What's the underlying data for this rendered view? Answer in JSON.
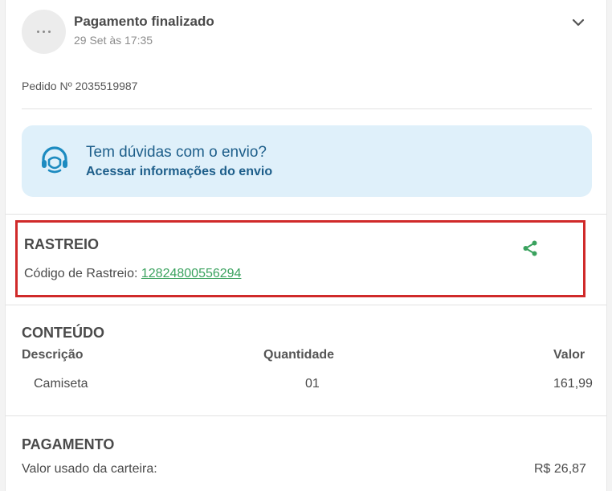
{
  "header": {
    "title": "Pagamento finalizado",
    "date": "29 Set às 17:35"
  },
  "order": {
    "label": "Pedido Nº 2035519987"
  },
  "banner": {
    "question": "Tem dúvidas com o envio?",
    "link": "Acessar informações do envio"
  },
  "tracking": {
    "title": "RASTREIO",
    "code_label": "Código de Rastreio:",
    "code": "12824800556294"
  },
  "content": {
    "title": "CONTEÚDO",
    "columns": [
      "Descrição",
      "Quantidade",
      "Valor"
    ],
    "rows": [
      {
        "description": "Camiseta",
        "quantity": "01",
        "value": "161,99"
      }
    ]
  },
  "payment": {
    "title": "PAGAMENTO",
    "wallet_label": "Valor usado da carteira:",
    "wallet_value": "R$ 26,87"
  },
  "icons": {
    "more": "more-dots-icon",
    "expand": "chevron-down-icon",
    "support": "headset-icon",
    "share": "share-icon"
  },
  "colors": {
    "link_blue": "#1d5e8a",
    "banner_bg": "#dff0fa",
    "accent_green": "#3aa25e",
    "highlight_red": "#d02a2a"
  }
}
